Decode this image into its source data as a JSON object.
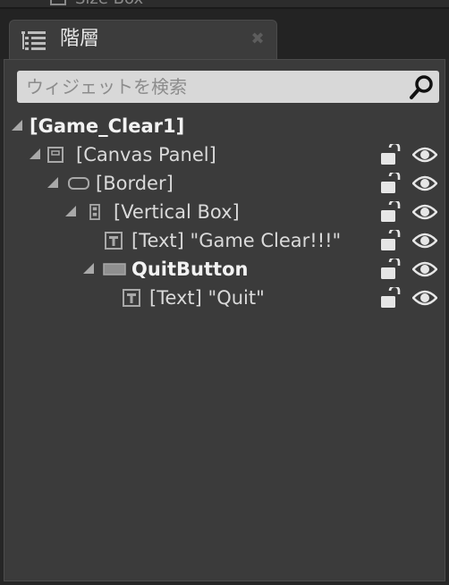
{
  "top_fragment": "Size Box",
  "tab": {
    "title": "階層",
    "icon": "hierarchy-list-icon",
    "close_glyph": "✖"
  },
  "search": {
    "placeholder": "ウィジェットを検索",
    "value": ""
  },
  "tree": {
    "root": "[Game_Clear1]",
    "nodes": [
      {
        "label": "[Canvas Panel]",
        "icon": "canvas-panel-icon",
        "bold": false
      },
      {
        "label": "[Border]",
        "icon": "border-icon",
        "bold": false
      },
      {
        "label": "[Vertical Box]",
        "icon": "vertical-box-icon",
        "bold": false
      },
      {
        "label": "[Text] \"Game Clear!!!\"",
        "icon": "text-icon",
        "bold": false
      },
      {
        "label": "QuitButton",
        "icon": "button-icon",
        "bold": true
      },
      {
        "label": "[Text] \"Quit\"",
        "icon": "text-icon",
        "bold": false
      }
    ]
  },
  "colors": {
    "panel_bg": "#3b3b3b",
    "tab_bg": "#3c3c3c",
    "search_bg": "#d8d8d8",
    "text": "#dadada"
  }
}
